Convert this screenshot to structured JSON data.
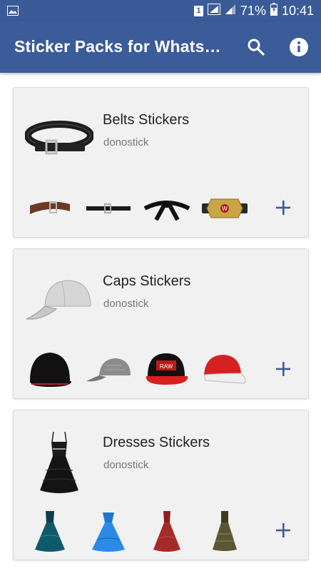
{
  "status_bar": {
    "sim_label": "1",
    "battery_percent": "71%",
    "time": "10:41"
  },
  "app_bar": {
    "title": "Sticker Packs for Whats…",
    "search_icon": "search-icon",
    "info_icon": "info-icon"
  },
  "packs": [
    {
      "title": "Belts Stickers",
      "author": "donostick",
      "stickers": [
        "brown-belt",
        "black-thin-belt",
        "karate-black-belt",
        "championship-belt"
      ]
    },
    {
      "title": "Caps Stickers",
      "author": "donostick",
      "stickers": [
        "black-cap",
        "grey-cap",
        "black-red-cap",
        "red-white-cap"
      ]
    },
    {
      "title": "Dresses Stickers",
      "author": "donostick",
      "stickers": [
        "teal-ball-gown",
        "blue-ball-gown",
        "red-ball-gown",
        "olive-dress"
      ]
    }
  ],
  "colors": {
    "primary": "#3b5b99",
    "card_background": "#f1f1f1",
    "add_icon": "#3b5b99"
  }
}
